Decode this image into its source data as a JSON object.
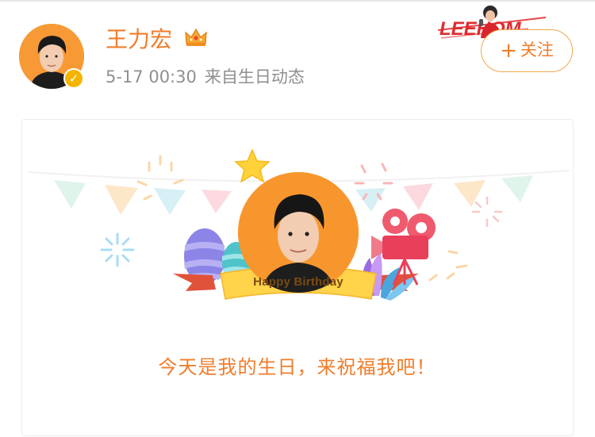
{
  "post": {
    "username": "王力宏",
    "timestamp": "5-17 00:30",
    "source": "来自生日动态",
    "follow_plus": "+",
    "follow_label": "关注",
    "badge_check": "✓"
  },
  "banner": {
    "logo_text": "LEEHOM"
  },
  "birthday_card": {
    "ribbon_text": "Happy Birthday",
    "message": "今天是我的生日，来祝福我吧！"
  },
  "colors": {
    "accent": "#ef7d2b",
    "verified": "#f5b400",
    "meta_gray": "#8f8f8f"
  }
}
